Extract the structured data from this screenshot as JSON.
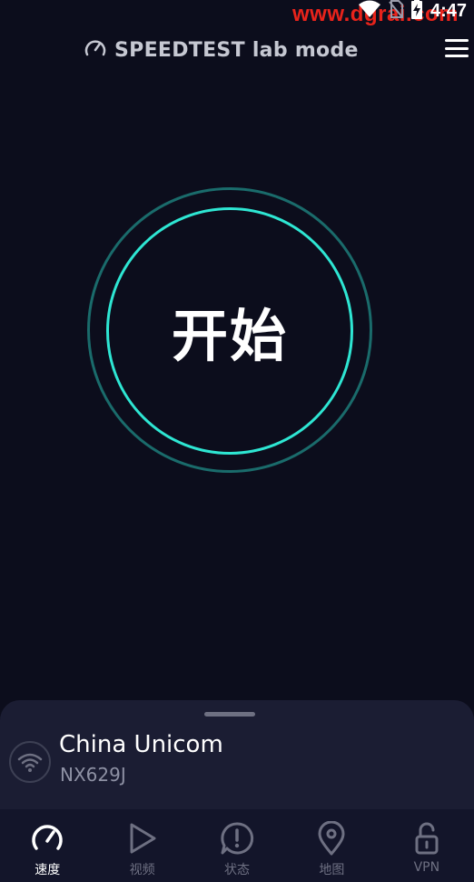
{
  "status_bar": {
    "watermark": "www.dgrai.com",
    "time": "4:47",
    "icons": [
      "wifi-icon",
      "no-sim-icon",
      "battery-charging-icon"
    ]
  },
  "header": {
    "title": "SPEEDTEST lab mode",
    "logo_icon": "speedometer-icon",
    "menu_icon": "hamburger-menu-icon"
  },
  "go_button": {
    "label": "开始",
    "outer_ring_color": "#1a6b6b",
    "inner_ring_color": "#2ee6d3"
  },
  "connection": {
    "isp": "China Unicom",
    "server": "NX629J",
    "icon": "wifi-icon"
  },
  "nav": {
    "items": [
      {
        "label": "速度",
        "icon": "speedometer-icon",
        "active": true
      },
      {
        "label": "视频",
        "icon": "play-icon",
        "active": false
      },
      {
        "label": "状态",
        "icon": "alert-bubble-icon",
        "active": false
      },
      {
        "label": "地图",
        "icon": "map-pin-icon",
        "active": false
      },
      {
        "label": "VPN",
        "icon": "lock-icon",
        "active": false
      }
    ]
  },
  "colors": {
    "background": "#0c0d1c",
    "sheet": "#1b1d33",
    "accent": "#2ee6d3",
    "muted": "#6e7082"
  }
}
